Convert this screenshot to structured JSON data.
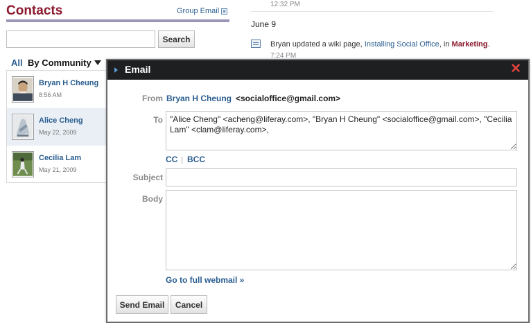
{
  "contacts": {
    "title": "Contacts",
    "group_email_label": "Group Email",
    "search_placeholder": "",
    "search_button": "Search",
    "filter_all": "All",
    "filter_community": "By Community",
    "items": [
      {
        "name": "Bryan H Cheung",
        "date": "8:56 AM",
        "avatar": "avatar-bryan"
      },
      {
        "name": "Alice Cheng",
        "date": "May 22, 2009",
        "avatar": "avatar-alice"
      },
      {
        "name": "Cecilia Lam",
        "date": "May 21, 2009",
        "avatar": "avatar-cecilia"
      }
    ]
  },
  "activity": {
    "time_prev": "12:32 PM",
    "date_heading": "June 9",
    "entry_prefix": "Bryan updated a wiki page, ",
    "entry_link": "Installing Social Office",
    "entry_middle": ", in ",
    "entry_community": "Marketing",
    "entry_suffix": ".",
    "entry_time": "7:24 PM",
    "icon": "wiki-page-icon"
  },
  "email_dialog": {
    "title": "Email",
    "close_icon": "close-icon",
    "from_label": "From",
    "from_name": "Bryan H Cheung",
    "from_email": "<socialoffice@gmail.com>",
    "to_label": "To",
    "to_value": "\"Alice Cheng\" <acheng@liferay.com>, \"Bryan H Cheung\" <socialoffice@gmail.com>, \"Cecilia Lam\" <clam@liferay.com>,",
    "cc_label": "CC",
    "separator": "|",
    "bcc_label": "BCC",
    "subject_label": "Subject",
    "subject_value": "",
    "body_label": "Body",
    "body_value": "",
    "webmail_link": "Go to full webmail »",
    "send_button": "Send Email",
    "cancel_button": "Cancel"
  },
  "colors": {
    "brand": "#8b1a2e",
    "link": "#2a5d8f",
    "dialog_bar": "#1d1f20",
    "close": "#e0453e"
  }
}
